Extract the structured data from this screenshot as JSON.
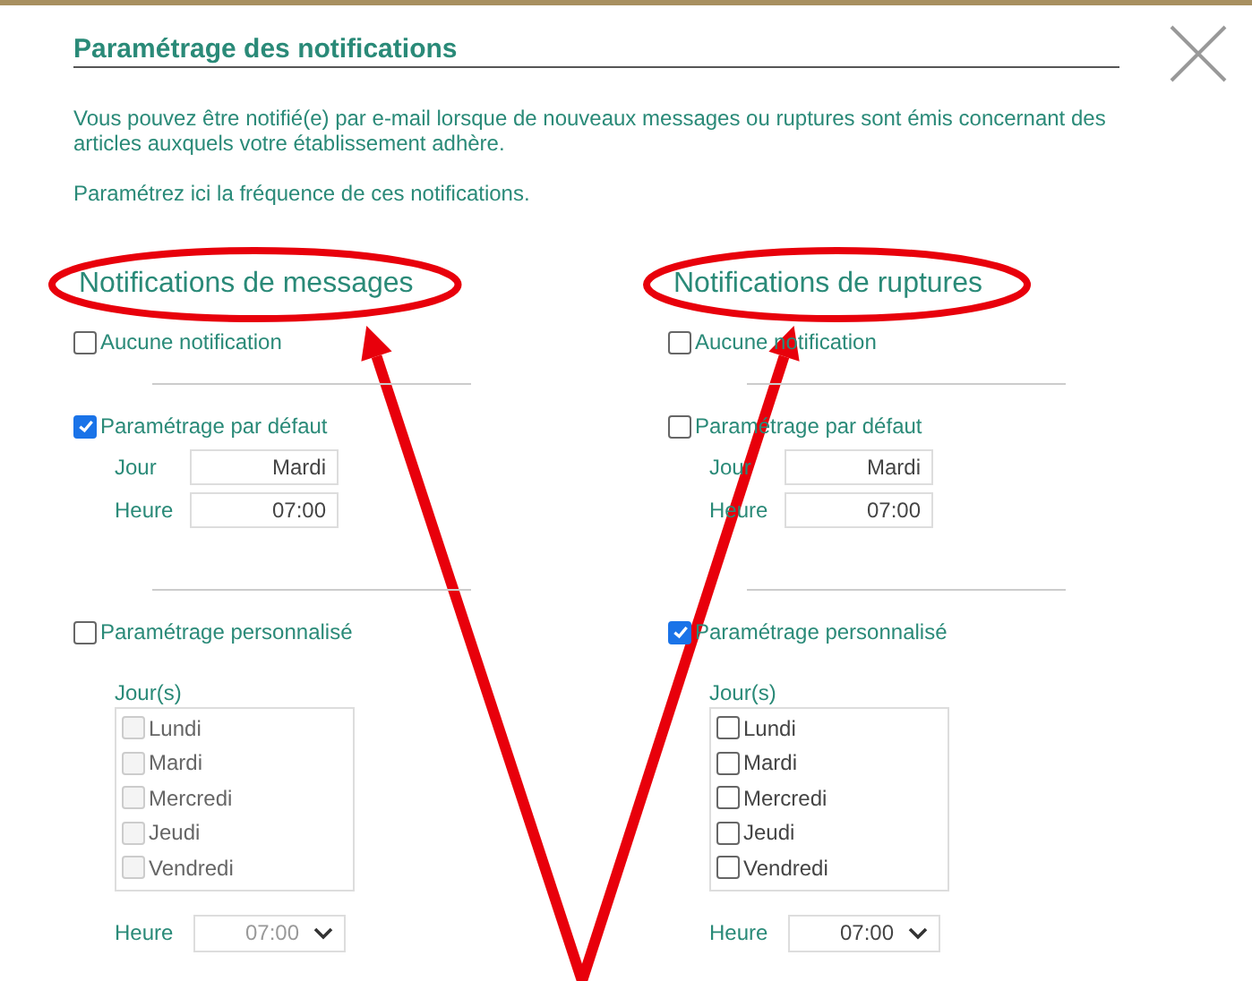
{
  "dialog": {
    "title": "Paramétrage des notifications",
    "intro": "Vous pouvez être notifié(e) par e-mail lorsque de nouveaux messages ou ruptures sont émis concernant des articles auxquels votre établissement adhère.",
    "hint": "Paramétrez ici la fréquence de ces notifications."
  },
  "sections": [
    {
      "heading": "Notifications de messages",
      "highlighted": true,
      "none": {
        "label": "Aucune notification",
        "checked": false
      },
      "default": {
        "label": "Paramétrage par défaut",
        "checked": true,
        "fields": [
          {
            "label": "Jour",
            "value": "Mardi"
          },
          {
            "label": "Heure",
            "value": "07:00"
          }
        ]
      },
      "custom": {
        "label": "Paramétrage personnalisé",
        "checked": false,
        "days_label": "Jour(s)",
        "days": [
          {
            "label": "Lundi",
            "checked": false,
            "disabled": true
          },
          {
            "label": "Mardi",
            "checked": false,
            "disabled": true
          },
          {
            "label": "Mercredi",
            "checked": false,
            "disabled": true
          },
          {
            "label": "Jeudi",
            "checked": false,
            "disabled": true
          },
          {
            "label": "Vendredi",
            "checked": false,
            "disabled": true
          }
        ],
        "time_label": "Heure",
        "time_value": "07:00",
        "time_disabled": true
      }
    },
    {
      "heading": "Notifications de ruptures",
      "highlighted": true,
      "none": {
        "label": "Aucune notification",
        "checked": false
      },
      "default": {
        "label": "Paramétrage par défaut",
        "checked": false,
        "fields": [
          {
            "label": "Jour",
            "value": "Mardi"
          },
          {
            "label": "Heure",
            "value": "07:00"
          }
        ]
      },
      "custom": {
        "label": "Paramétrage personnalisé",
        "checked": true,
        "days_label": "Jour(s)",
        "days": [
          {
            "label": "Lundi",
            "checked": false,
            "disabled": false
          },
          {
            "label": "Mardi",
            "checked": false,
            "disabled": false
          },
          {
            "label": "Mercredi",
            "checked": false,
            "disabled": false
          },
          {
            "label": "Jeudi",
            "checked": false,
            "disabled": false
          },
          {
            "label": "Vendredi",
            "checked": false,
            "disabled": false
          }
        ],
        "time_label": "Heure",
        "time_value": "07:00",
        "time_disabled": false
      }
    }
  ]
}
